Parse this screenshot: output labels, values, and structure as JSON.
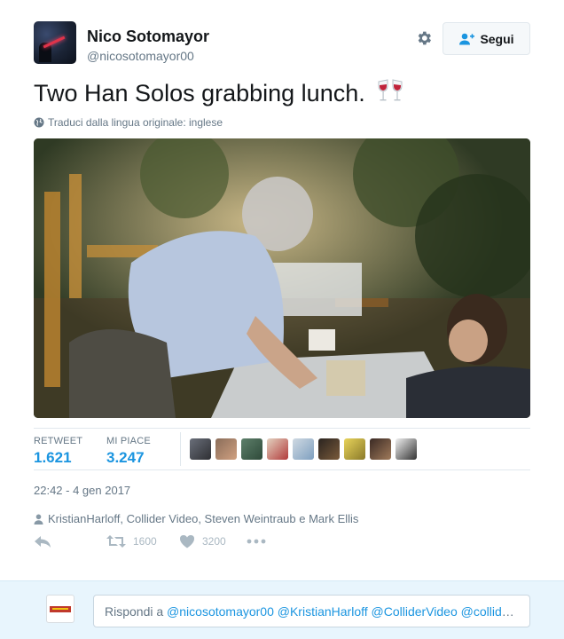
{
  "author": {
    "name": "Nico Sotomayor",
    "handle": "@nicosotomayor00"
  },
  "header": {
    "follow_label": "Segui"
  },
  "tweet": {
    "text": "Two Han Solos grabbing lunch.",
    "emoji_icon": "wine-glasses-icon",
    "translate_label": "Traduci dalla lingua originale: inglese"
  },
  "stats": {
    "retweet_label": "RETWEET",
    "retweet_count": "1.621",
    "like_label": "MI PIACE",
    "like_count": "3.247"
  },
  "timestamp": "22:42 - 4 gen 2017",
  "mentions": "KristianHarloff, Collider Video, Steven Weintraub e Mark Ellis",
  "actions": {
    "retweet_count": "1600",
    "like_count": "3200"
  },
  "reply": {
    "prefix": "Rispondi a ",
    "mentions": "@nicosotomayor00 @KristianHarloff @ColliderVideo @collide…"
  },
  "colors": {
    "accent": "#1b95e0",
    "muted": "#657786",
    "reply_bg": "#e8f5fd"
  }
}
